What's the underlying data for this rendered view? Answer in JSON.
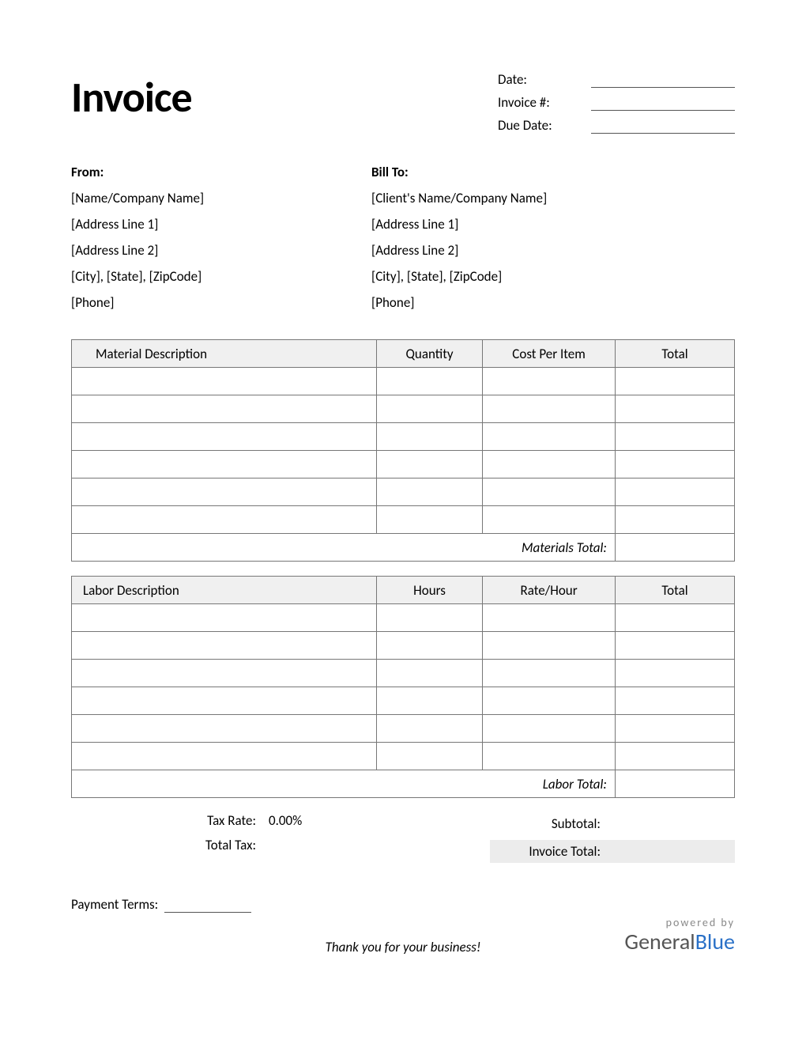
{
  "title": "Invoice",
  "meta": {
    "date_label": "Date:",
    "invoice_num_label": "Invoice #:",
    "due_date_label": "Due Date:"
  },
  "from": {
    "heading": "From:",
    "line1": "[Name/Company Name]",
    "line2": "[Address Line 1]",
    "line3": "[Address Line 2]",
    "line4": "[City], [State], [ZipCode]",
    "line5": "[Phone]"
  },
  "billto": {
    "heading": "Bill To:",
    "line1": "[Client's Name/Company Name]",
    "line2": "[Address Line 1]",
    "line3": "[Address Line 2]",
    "line4": "[City], [State], [ZipCode]",
    "line5": "[Phone]"
  },
  "materials": {
    "headers": {
      "desc": "Material Description",
      "qty": "Quantity",
      "cost": "Cost Per Item",
      "total": "Total"
    },
    "subtotal_label": "Materials Total:"
  },
  "labor": {
    "headers": {
      "desc": "Labor Description",
      "hours": "Hours",
      "rate": "Rate/Hour",
      "total": "Total"
    },
    "subtotal_label": "Labor Total:"
  },
  "tax": {
    "rate_label": "Tax Rate:",
    "rate_value": "0.00%",
    "total_tax_label": "Total Tax:"
  },
  "summary": {
    "subtotal_label": "Subtotal:",
    "invoice_total_label": "Invoice Total:"
  },
  "payment_terms_label": "Payment Terms:",
  "thanks": "Thank you for your business!",
  "powered": {
    "small": "powered by",
    "general": "General",
    "blue": "Blue"
  }
}
